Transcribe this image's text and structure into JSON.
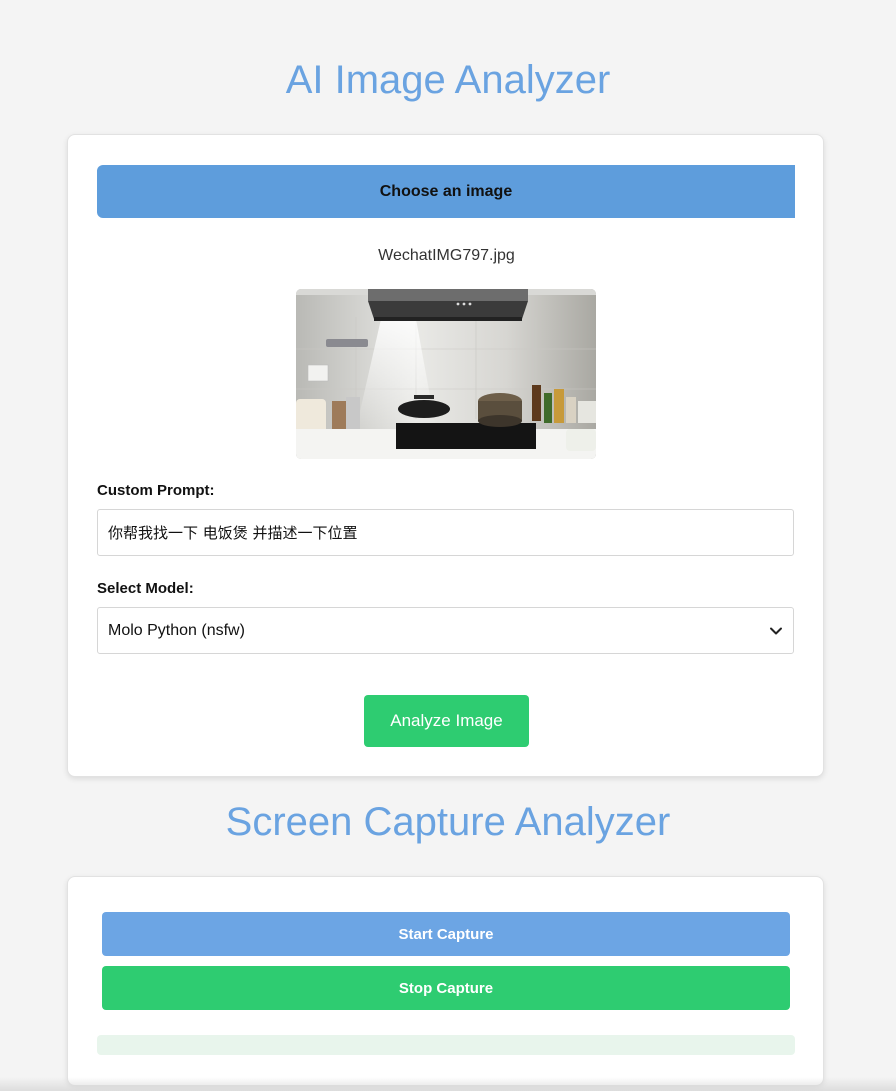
{
  "image_analyzer": {
    "title": "AI Image Analyzer",
    "choose_button_label": "Choose an image",
    "file_name": "WechatIMG797.jpg",
    "prompt_label": "Custom Prompt:",
    "prompt_value": "你帮我找一下 电饭煲 并描述一下位置",
    "model_label": "Select Model:",
    "model_selected": "Molo Python (nsfw)",
    "analyze_button_label": "Analyze Image"
  },
  "screen_capture": {
    "title": "Screen Capture Analyzer",
    "start_button_label": "Start Capture",
    "stop_button_label": "Stop Capture"
  },
  "colors": {
    "title": "#6aa3e1",
    "choose_button": "#5e9ddc",
    "start_button": "#6ca5e4",
    "green_button": "#2ecc71",
    "result_bar": "#e8f5ec"
  }
}
